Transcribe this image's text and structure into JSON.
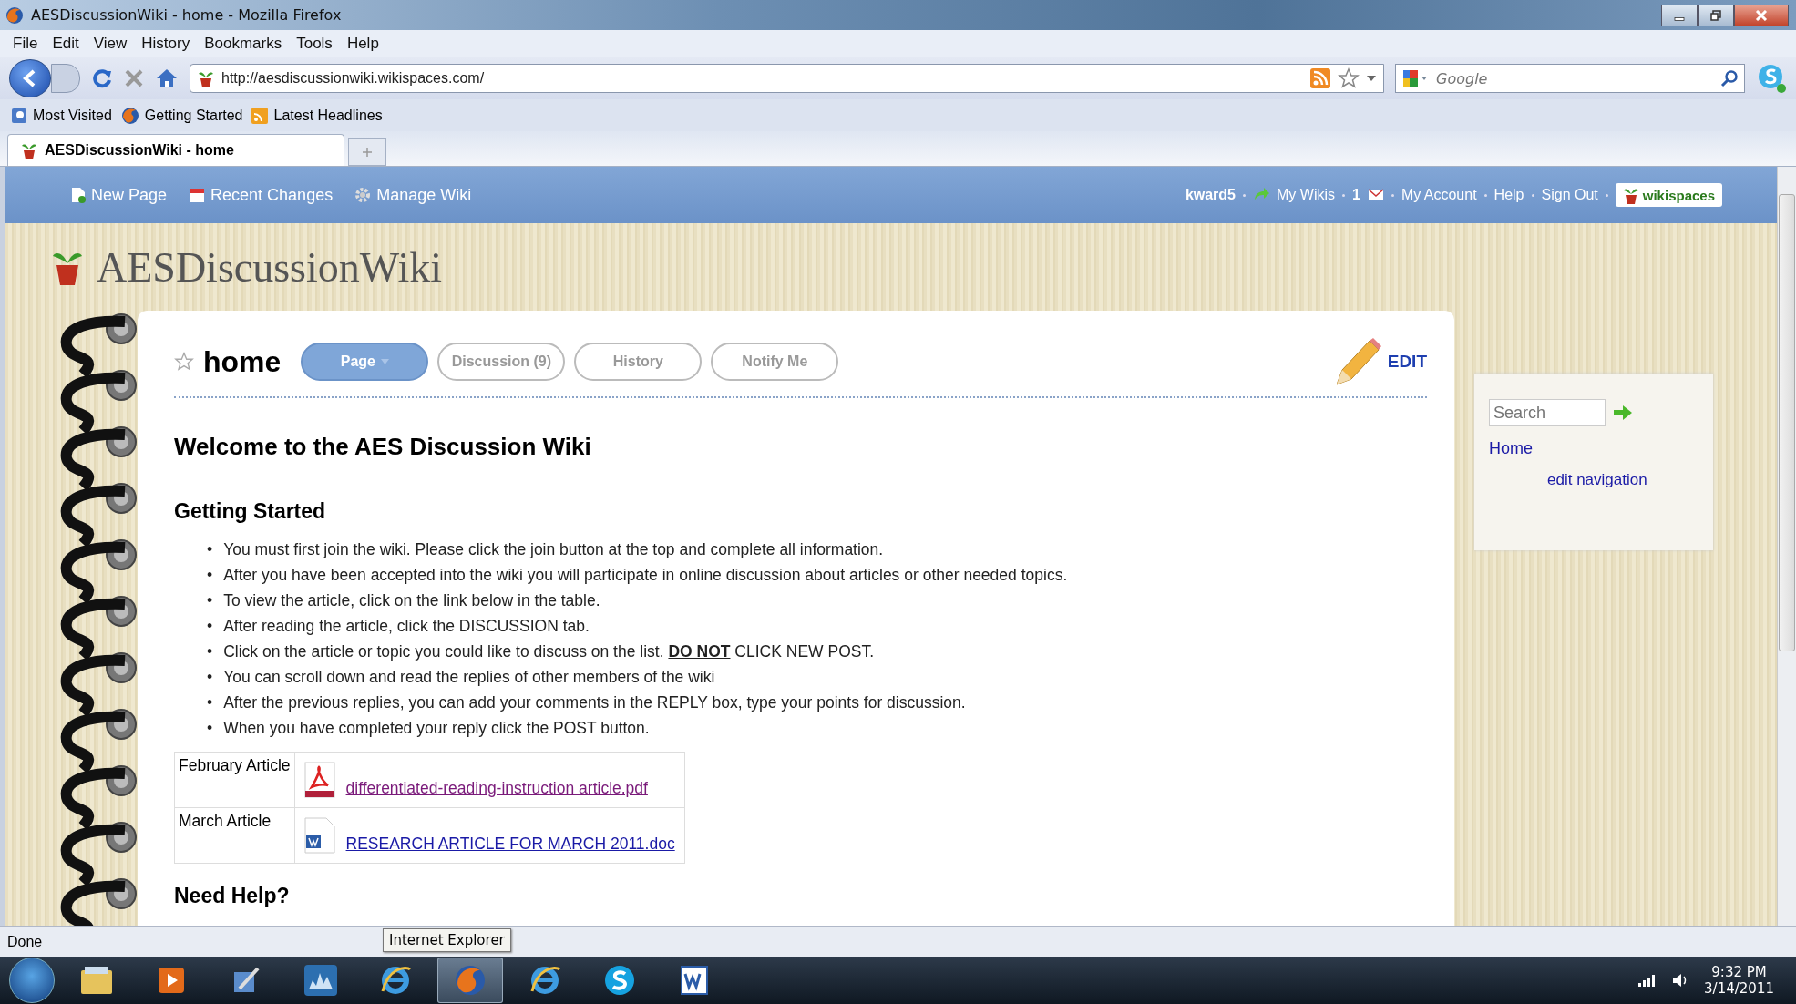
{
  "window": {
    "title": "AESDiscussionWiki - home - Mozilla Firefox"
  },
  "menu": [
    "File",
    "Edit",
    "View",
    "History",
    "Bookmarks",
    "Tools",
    "Help"
  ],
  "nav": {
    "url": "http://aesdiscussionwiki.wikispaces.com/",
    "search_placeholder": "Google"
  },
  "bookmarks": [
    "Most Visited",
    "Getting Started",
    "Latest Headlines"
  ],
  "tabs": [
    {
      "label": "AESDiscussionWiki - home",
      "selected": true
    }
  ],
  "wiki_bar": {
    "left": [
      {
        "kind": "page",
        "label": "New Page"
      },
      {
        "kind": "calendar",
        "label": "Recent Changes"
      },
      {
        "kind": "gear",
        "label": "Manage Wiki"
      }
    ],
    "user": "kward5",
    "my_wikis": "My Wikis",
    "messages": "1",
    "links": [
      "My Account",
      "Help",
      "Sign Out"
    ],
    "brand": "wikispaces"
  },
  "site_title": "AESDiscussionWiki",
  "page": {
    "title": "home",
    "tabs": [
      {
        "label": "Page",
        "selected": true
      },
      {
        "label": "Discussion (9)",
        "selected": false
      },
      {
        "label": "History",
        "selected": false
      },
      {
        "label": "Notify Me",
        "selected": false
      }
    ],
    "edit": "EDIT",
    "heading": "Welcome to the AES Discussion Wiki",
    "subheading": "Getting Started",
    "bullets": [
      {
        "marker": "•",
        "text": "You must first join the wiki. Please click the join button at the top and complete all information."
      },
      {
        "marker": "•",
        "text": "After you have been accepted into the wiki you will participate in online discussion about articles or other needed topics."
      },
      {
        "marker": "•",
        "text": "To view the article, click on the link below in the table."
      },
      {
        "marker": "•",
        "text": "After reading the article, click the DISCUSSION tab."
      },
      {
        "marker": "•",
        "text": "Click on the article or topic you could like to discuss on the list. **DO NOT** CLICK NEW POST."
      },
      {
        "marker": "•",
        "text": "You can scroll down and read the replies of other members of the wiki"
      },
      {
        "marker": "•",
        "text": "After the previous replies, you can add your comments in the REPLY box, type your points for discussion."
      },
      {
        "marker": "•",
        "text": "When you have completed your reply click the POST button."
      }
    ],
    "table": [
      {
        "label": "February Article",
        "kind": "pdf",
        "file": "differentiated-reading-instruction article.pdf",
        "visited": true
      },
      {
        "label": "March Article",
        "kind": "doc",
        "file": "RESEARCH ARTICLE FOR MARCH 2011.doc",
        "visited": false
      }
    ],
    "help_heading": "Need Help?"
  },
  "sidebar": {
    "search_placeholder": "Search",
    "links": [
      "Home"
    ],
    "edit_link": "edit navigation"
  },
  "status_bar": "Done",
  "tooltip": "Internet Explorer",
  "taskbar": [
    {
      "kind": "explorer",
      "selected": false
    },
    {
      "kind": "media",
      "selected": false
    },
    {
      "kind": "paint",
      "selected": false
    },
    {
      "kind": "wimax",
      "selected": false
    },
    {
      "kind": "ie",
      "selected": false
    },
    {
      "kind": "firefox",
      "selected": true
    },
    {
      "kind": "ie",
      "selected": false
    },
    {
      "kind": "skype",
      "selected": false
    },
    {
      "kind": "word",
      "selected": false
    }
  ],
  "clock": {
    "time": "9:32 PM",
    "date": "3/14/2011"
  }
}
